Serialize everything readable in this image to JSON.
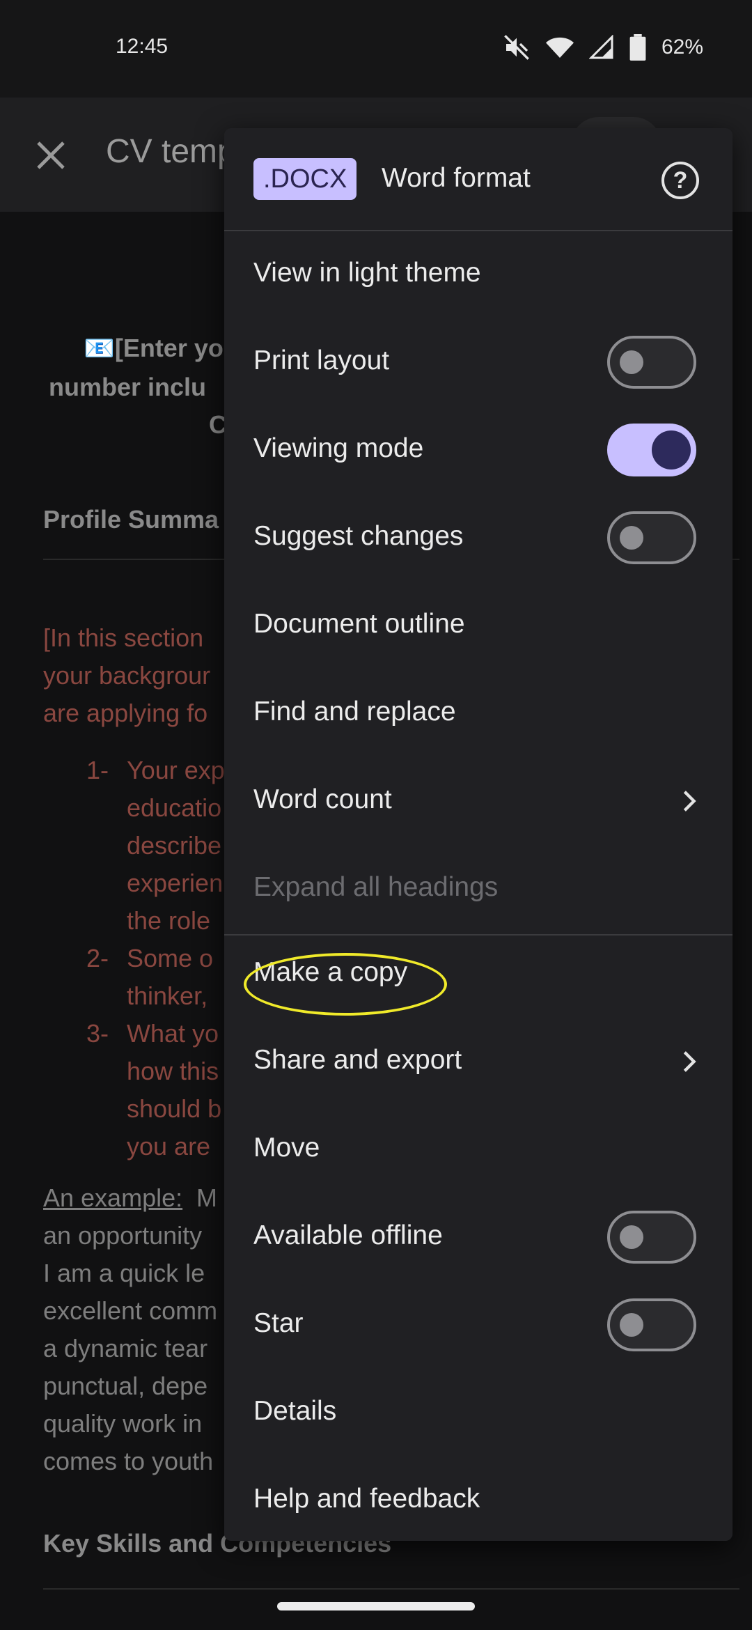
{
  "status_bar": {
    "time": "12:45",
    "battery_percent": "62%",
    "icons": [
      "mute-icon",
      "wifi-icon",
      "signal-icon",
      "battery-icon"
    ]
  },
  "app_bar": {
    "title": "CV temp",
    "close_icon": "close-icon"
  },
  "document": {
    "lines": [
      "📧[Enter yo",
      "number inclu",
      "C",
      "Profile Summa",
      "[In this section",
      "your backgrour",
      "are applying fo",
      "1-",
      "Your exp",
      "educatio",
      "describe",
      "experien",
      "the role",
      "2-",
      "Some o",
      "thinker,",
      "3-",
      "What yo",
      "how this",
      "should b",
      "you are",
      "An example:",
      " M",
      "an opportunity",
      "I am a quick le",
      "excellent comm",
      "a dynamic tear",
      "punctual, depe",
      "quality work in",
      "comes to youth",
      "Key Skills and Competencies"
    ]
  },
  "menu": {
    "badge": ".DOCX",
    "format_label": "Word format",
    "help_icon": "help-icon",
    "items": [
      {
        "label": "View in light theme"
      },
      {
        "label": "Print layout",
        "toggle": false
      },
      {
        "label": "Viewing mode",
        "toggle": true
      },
      {
        "label": "Suggest changes",
        "toggle": false
      },
      {
        "label": "Document outline"
      },
      {
        "label": "Find and replace"
      },
      {
        "label": "Word count",
        "submenu": true
      },
      {
        "label": "Expand all headings",
        "disabled": true
      },
      {
        "label": "Make a copy",
        "highlighted": true
      },
      {
        "label": "Share and export",
        "submenu": true
      },
      {
        "label": "Move"
      },
      {
        "label": "Available offline",
        "toggle": false
      },
      {
        "label": "Star",
        "toggle": false
      },
      {
        "label": "Details"
      },
      {
        "label": "Help and feedback"
      }
    ]
  },
  "colors": {
    "accent": "#c8bfff",
    "highlight": "#f0ea2a",
    "menu_bg": "#202023"
  }
}
